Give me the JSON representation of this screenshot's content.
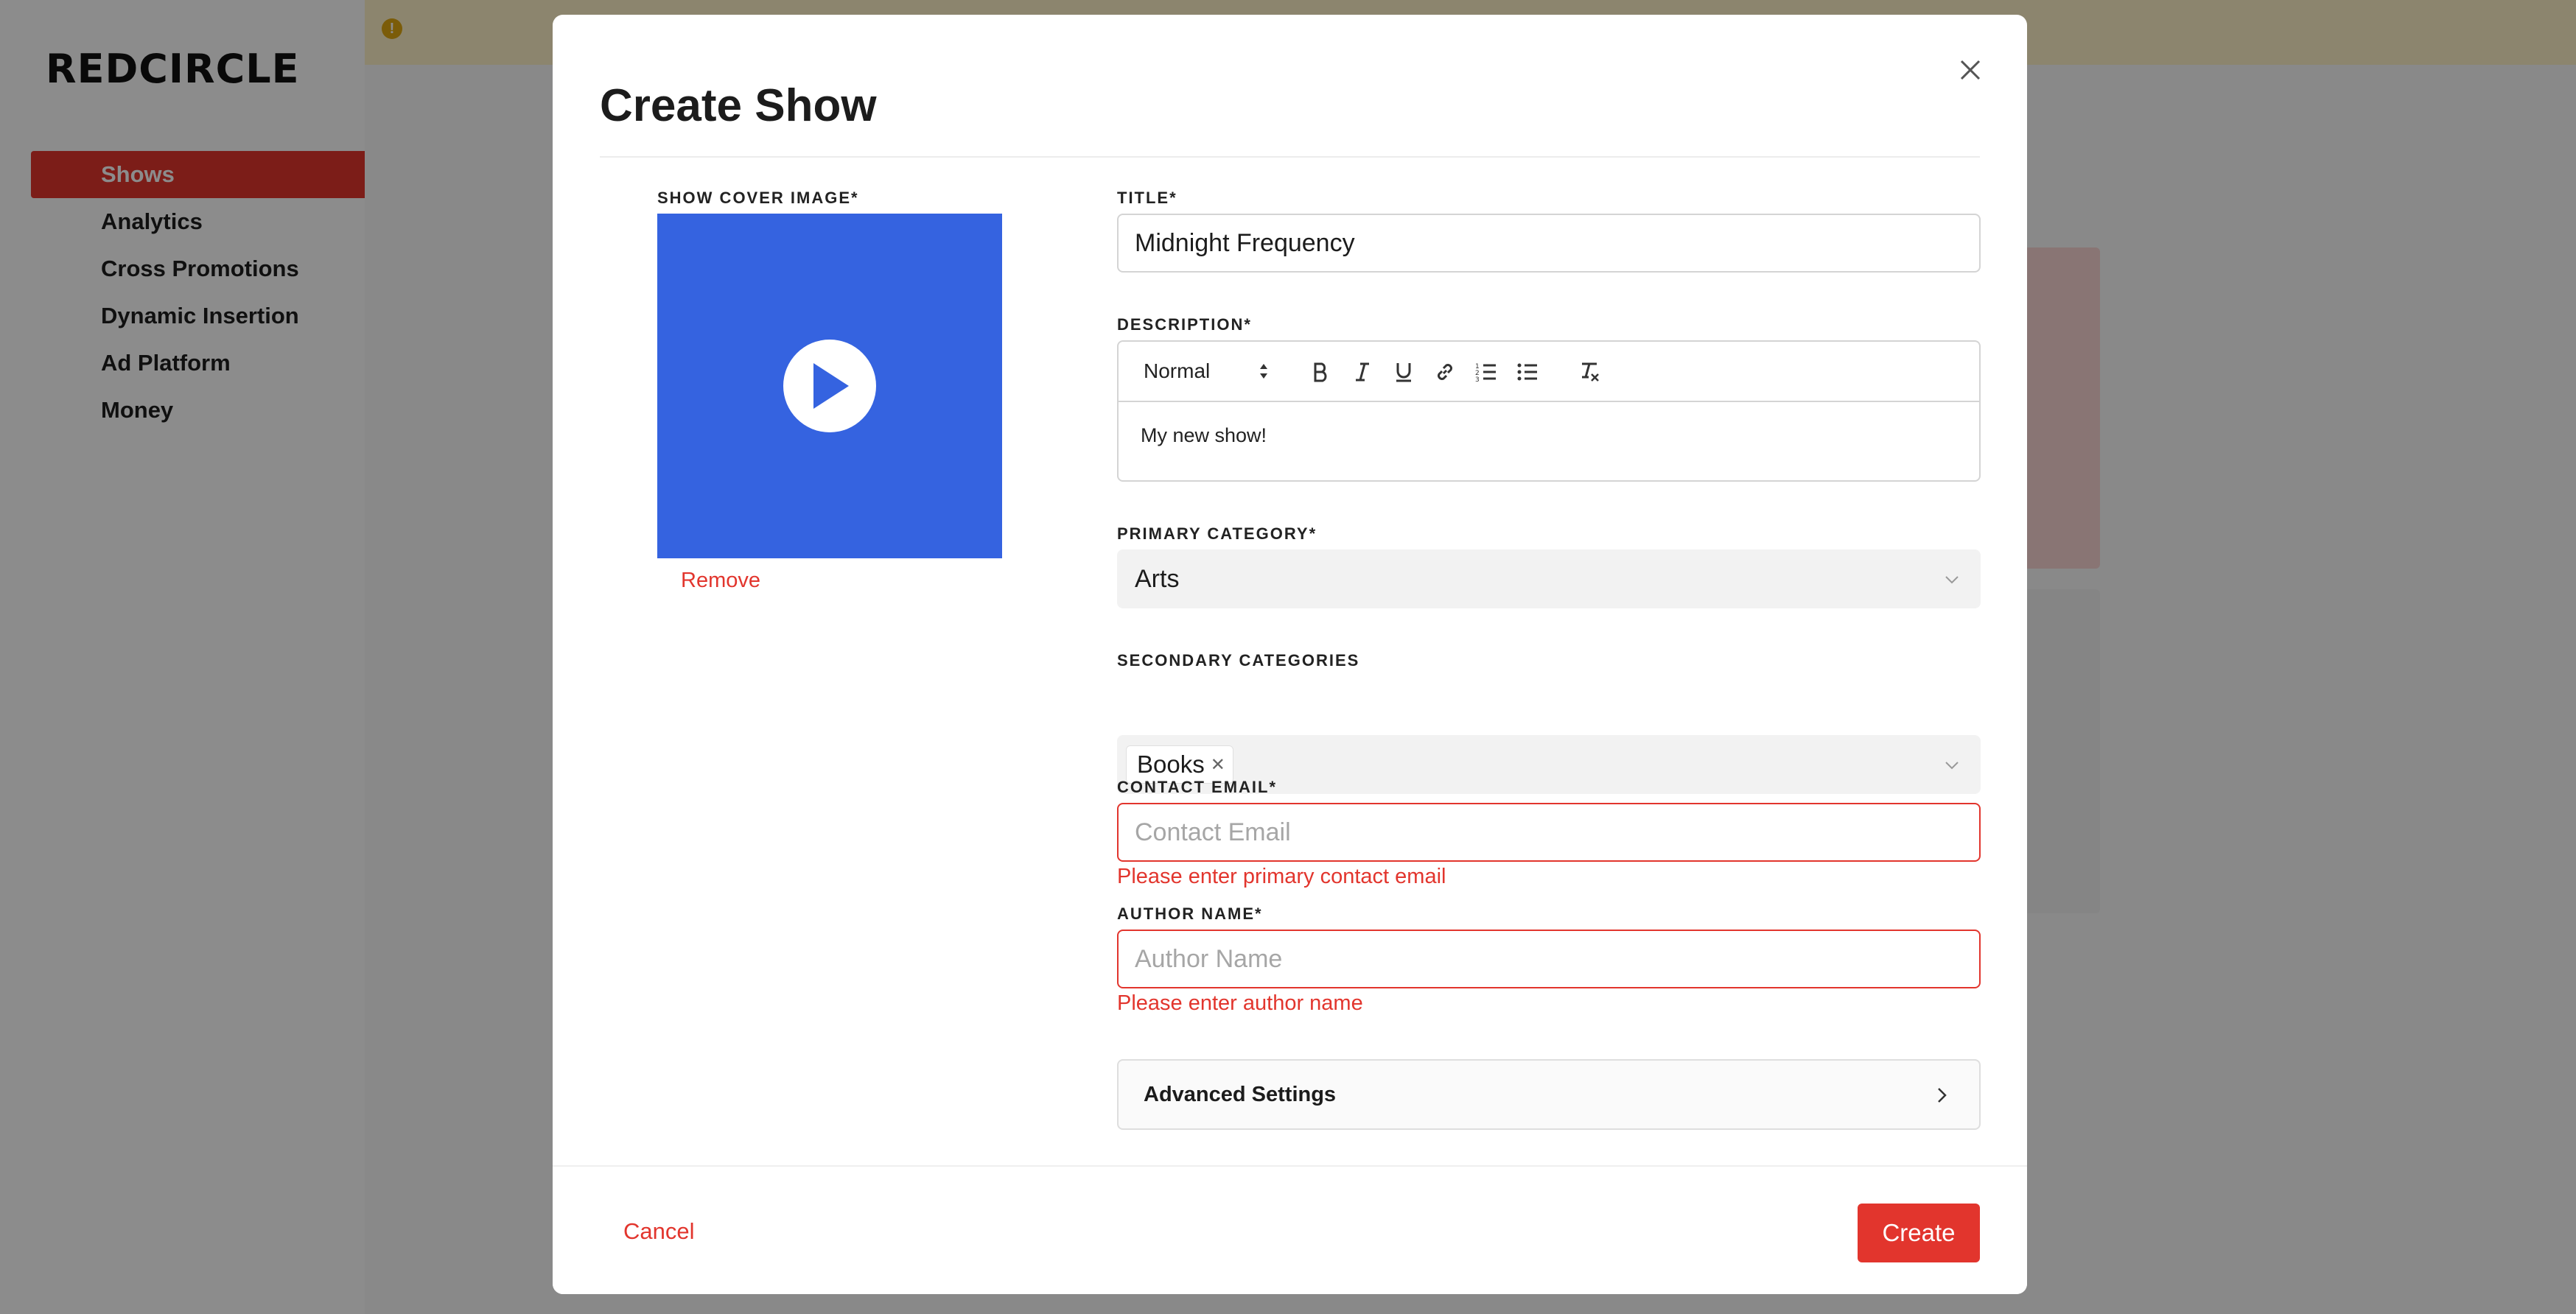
{
  "app": {
    "logo_text": "REDCIRCLE",
    "sidebar": {
      "items": [
        {
          "label": "Shows"
        },
        {
          "label": "Analytics"
        },
        {
          "label": "Cross Promotions"
        },
        {
          "label": "Dynamic Insertion"
        },
        {
          "label": "Ad Platform"
        },
        {
          "label": "Money"
        }
      ],
      "active_index": 0
    },
    "warning_icon": "!"
  },
  "modal": {
    "title": "Create Show",
    "cover": {
      "label": "SHOW COVER IMAGE*",
      "remove_label": "Remove",
      "color": "#3563e0"
    },
    "title_field": {
      "label": "TITLE*",
      "value": "Midnight Frequency"
    },
    "description": {
      "label": "DESCRIPTION*",
      "format_value": "Normal",
      "toolbar_icons": [
        "bold-icon",
        "italic-icon",
        "underline-icon",
        "link-icon",
        "ordered-list-icon",
        "bullet-list-icon",
        "clear-format-icon"
      ],
      "value": "My new show!"
    },
    "primary_category": {
      "label": "PRIMARY CATEGORY*",
      "value": "Arts"
    },
    "secondary_categories": {
      "label": "SECONDARY CATEGORIES",
      "tags": [
        "Books"
      ]
    },
    "contact_email": {
      "label": "CONTACT EMAIL*",
      "placeholder": "Contact Email",
      "error": "Please enter primary contact email"
    },
    "author_name": {
      "label": "AUTHOR NAME*",
      "placeholder": "Author Name",
      "error": "Please enter author name"
    },
    "advanced_label": "Advanced Settings",
    "cancel_label": "Cancel",
    "create_label": "Create"
  },
  "colors": {
    "accent": "#e2352d",
    "cover": "#3563e0"
  }
}
